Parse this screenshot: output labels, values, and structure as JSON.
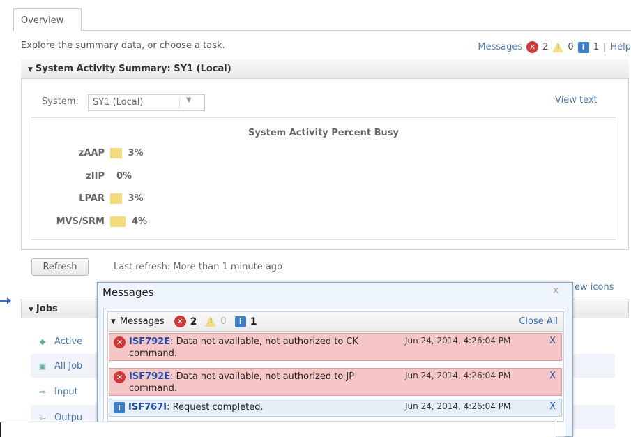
{
  "tabs": [
    {
      "label": "Overview"
    }
  ],
  "header": {
    "intro": "Explore the summary data, or choose a task.",
    "messages_label": "Messages",
    "error_count": "2",
    "warning_count": "0",
    "info_count": "1",
    "separator": "|",
    "help_label": "Help"
  },
  "summary": {
    "title": "System Activity Summary: SY1 (Local)",
    "system_label": "System:",
    "system_value": "SY1 (Local)",
    "view_text": "View text",
    "chart_title": "System Activity Percent Busy",
    "refresh_label": "Refresh",
    "last_refresh": "Last refresh: More than 1 minute ago"
  },
  "chart_data": {
    "type": "bar",
    "title": "System Activity Percent Busy",
    "categories": [
      "zAAP",
      "zIIP",
      "LPAR",
      "MVS/SRM"
    ],
    "values": [
      3,
      0,
      3,
      4
    ],
    "labels": [
      "3%",
      "0%",
      "3%",
      "4%"
    ]
  },
  "jobs": {
    "title": "Jobs",
    "view_icons": "ew icons",
    "items": [
      {
        "label": "Active"
      },
      {
        "label": "All Job"
      },
      {
        "label": "Input"
      },
      {
        "label": "Outpu"
      }
    ]
  },
  "popup": {
    "title": "Messages",
    "close": "x",
    "section_label": "Messages",
    "error_count": "2",
    "warning_count": "0",
    "info_count": "1",
    "close_all": "Close All",
    "messages": [
      {
        "code": "ISF792E",
        "text": ": Data not available, not authorized to CK command.",
        "date": "Jun 24, 2014, 4:26:04 PM",
        "dismiss": "X",
        "type": "error"
      },
      {
        "code": "ISF792E",
        "text": ": Data not available, not authorized to JP command.",
        "date": "Jun 24, 2014, 4:26:04 PM",
        "dismiss": "X",
        "type": "error"
      },
      {
        "code": "ISF767I",
        "text": ": Request completed.",
        "date": "Jun 24, 2014, 4:26:04 PM",
        "dismiss": "X",
        "type": "info"
      }
    ]
  },
  "colors": {
    "accent": "#4a78b0",
    "error": "#d23838",
    "bar": "#f4dc7c",
    "info": "#3a7fc8"
  }
}
